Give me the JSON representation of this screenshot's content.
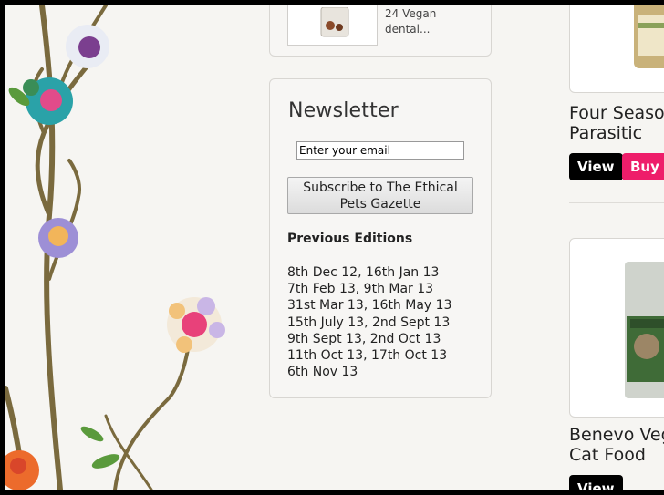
{
  "top_product": {
    "text_line1": "24 Vegan",
    "text_line2": "dental..."
  },
  "newsletter": {
    "title": "Newsletter",
    "email_placeholder": "Enter your email",
    "subscribe_label": "Subscribe to The Ethical Pets Gazette",
    "previous_title": "Previous Editions",
    "editions": [
      "8th Dec 12, 16th Jan 13",
      "7th Feb 13, 9th Mar 13",
      "31st Mar 13, 16th May 13",
      "15th July 13, 2nd Sept 13",
      "9th Sept 13, 2nd Oct 13",
      "11th Oct 13, 17th Oct 13",
      "6th Nov 13"
    ]
  },
  "products": [
    {
      "name_line1": "Four Seaso",
      "name_line2": "Parasitic",
      "view_label": "View",
      "buy_label": "Buy"
    },
    {
      "name_line1": "Benevo Veg",
      "name_line2": "Cat Food",
      "view_label": "View"
    }
  ],
  "colors": {
    "buy": "#ee1d6a",
    "view": "#000000",
    "background": "#f6f5f2"
  }
}
